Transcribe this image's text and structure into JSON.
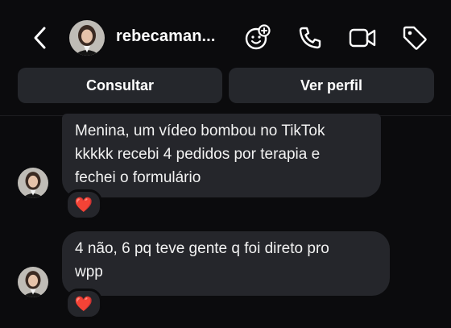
{
  "header": {
    "username": "rebecaman...",
    "back_icon": "chevron-left-icon",
    "icons": [
      "face-plus-icon",
      "phone-icon",
      "video-camera-icon",
      "tag-icon"
    ]
  },
  "actions": {
    "consult_label": "Consultar",
    "profile_label": "Ver perfil"
  },
  "messages": [
    {
      "text": "Menina, um vídeo bombou no TikTok\nkkkkk recebi 4 pedidos por terapia e\nfechei o formulário",
      "reaction": "❤️"
    },
    {
      "text": "4 não, 6 pq teve gente q foi direto pro\nwpp",
      "reaction": "❤️"
    }
  ],
  "colors": {
    "background": "#0b0b0d",
    "bubble": "#25262b",
    "button": "#25272c",
    "heart": "#e0192f"
  }
}
